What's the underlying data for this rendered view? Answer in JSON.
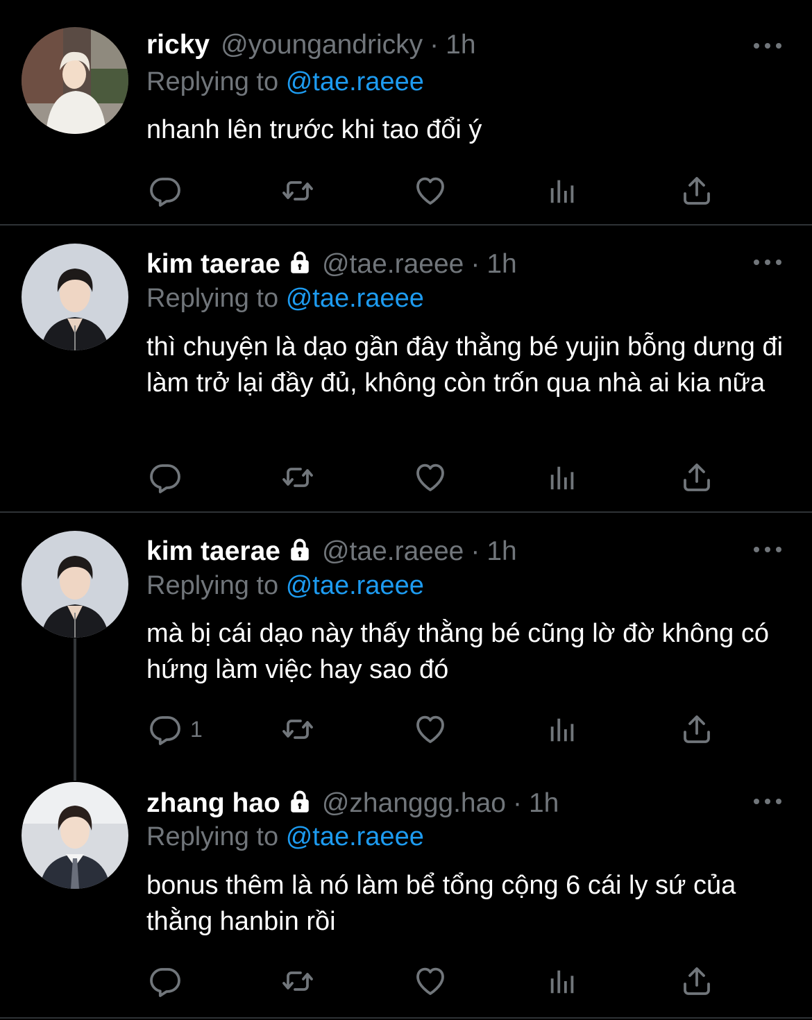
{
  "tweets": [
    {
      "name": "ricky",
      "locked": false,
      "handle": "@youngandricky",
      "separator": "·",
      "time": "1h",
      "replying_prefix": "Replying to",
      "replying_to": "@tae.raeee",
      "body": "nhanh lên trước khi tao đổi ý",
      "avatar_icon": "avatar-ricky",
      "reply_count": ""
    },
    {
      "name": "kim taerae",
      "locked": true,
      "handle": "@tae.raeee",
      "separator": "·",
      "time": "1h",
      "replying_prefix": "Replying to",
      "replying_to": "@tae.raeee",
      "body": "thì chuyện là dạo gần đây thằng bé yujin bỗng dưng đi làm trở lại đầy đủ, không còn trốn qua nhà ai kia nữa",
      "avatar_icon": "avatar-taerae",
      "reply_count": ""
    },
    {
      "name": "kim taerae",
      "locked": true,
      "handle": "@tae.raeee",
      "separator": "·",
      "time": "1h",
      "replying_prefix": "Replying to",
      "replying_to": "@tae.raeee",
      "body": "mà bị cái dạo này thấy thằng bé cũng lờ đờ không có hứng làm việc hay sao đó",
      "avatar_icon": "avatar-taerae",
      "reply_count": "1"
    },
    {
      "name": "zhang hao",
      "locked": true,
      "handle": "@zhanggg.hao",
      "separator": "·",
      "time": "1h",
      "replying_prefix": "Replying to",
      "replying_to": "@tae.raeee",
      "body": "bonus thêm là nó làm bể tổng cộng 6 cái ly sứ của thằng hanbin rồi",
      "avatar_icon": "avatar-zhanghao",
      "reply_count": ""
    }
  ],
  "action_icons": [
    "reply-icon",
    "retweet-icon",
    "like-icon",
    "views-icon",
    "share-icon"
  ],
  "colors": {
    "background": "#000000",
    "text": "#ffffff",
    "muted": "#71767b",
    "link": "#1d9bf0",
    "divider": "#2f3336"
  }
}
